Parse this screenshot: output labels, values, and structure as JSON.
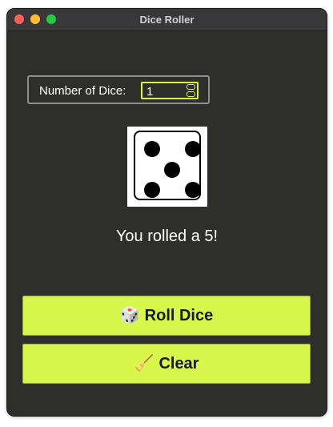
{
  "window": {
    "title": "Dice Roller"
  },
  "controls": {
    "dice_label": "Number of Dice:",
    "dice_count": "1"
  },
  "die": {
    "value": 5
  },
  "result_text": "You rolled a 5!",
  "buttons": {
    "roll": {
      "icon": "🎲",
      "icon_name": "dice-icon",
      "label": "Roll Dice"
    },
    "clear": {
      "icon": "🧹",
      "icon_name": "broom-icon",
      "label": "Clear"
    }
  },
  "colors": {
    "accent": "#d9f64c",
    "background": "#2e2e2b",
    "text": "#ffffff"
  }
}
